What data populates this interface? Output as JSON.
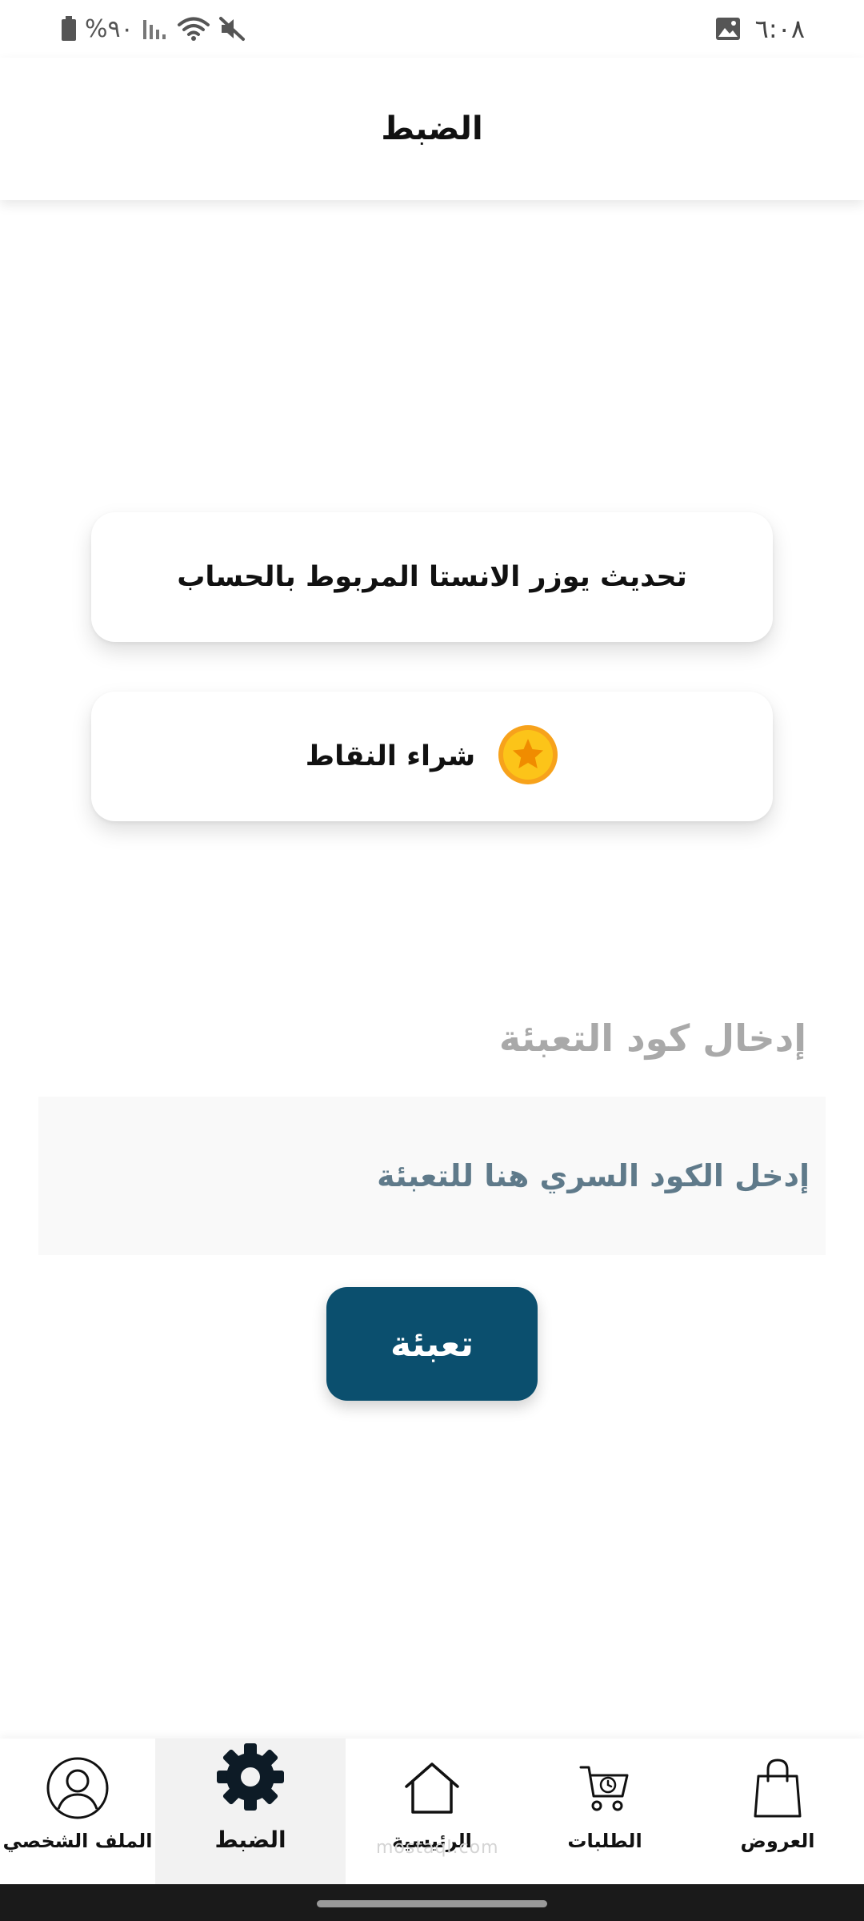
{
  "status_bar": {
    "battery_text": "%٩٠",
    "time": "٦:٠٨",
    "icons": [
      "battery-icon",
      "signal-icon",
      "wifi-icon",
      "mute-icon",
      "image-notification-icon"
    ]
  },
  "header": {
    "title": "الضبط"
  },
  "cards": {
    "update_instagram_label": "تحديث يوزر الانستا المربوط بالحساب",
    "buy_points_label": "شراء النقاط",
    "buy_points_icon": "coin-star-icon"
  },
  "recharge": {
    "section_title": "إدخال كود التعبئة",
    "code_value": "",
    "code_placeholder": "إدخل الكود السري هنا للتعبئة",
    "button_label": "تعبئة"
  },
  "bottom_nav": {
    "active": "settings",
    "items": [
      {
        "key": "profile",
        "label": "الملف الشخصي",
        "icon": "user-profile-icon"
      },
      {
        "key": "settings",
        "label": "الضبط",
        "icon": "gear-icon"
      },
      {
        "key": "home",
        "label": "الرئيسية",
        "icon": "home-icon"
      },
      {
        "key": "orders",
        "label": "الطلبات",
        "icon": "cart-clock-icon"
      },
      {
        "key": "offers",
        "label": "العروض",
        "icon": "shopping-bag-icon"
      }
    ]
  },
  "watermark": "mostaql.com",
  "colors": {
    "primary": "#0b4f6e",
    "section_title": "#a9a9a9",
    "placeholder": "#5f7a8a",
    "coin": "#f5b800",
    "active_nav_bg": "#f2f2f2"
  }
}
